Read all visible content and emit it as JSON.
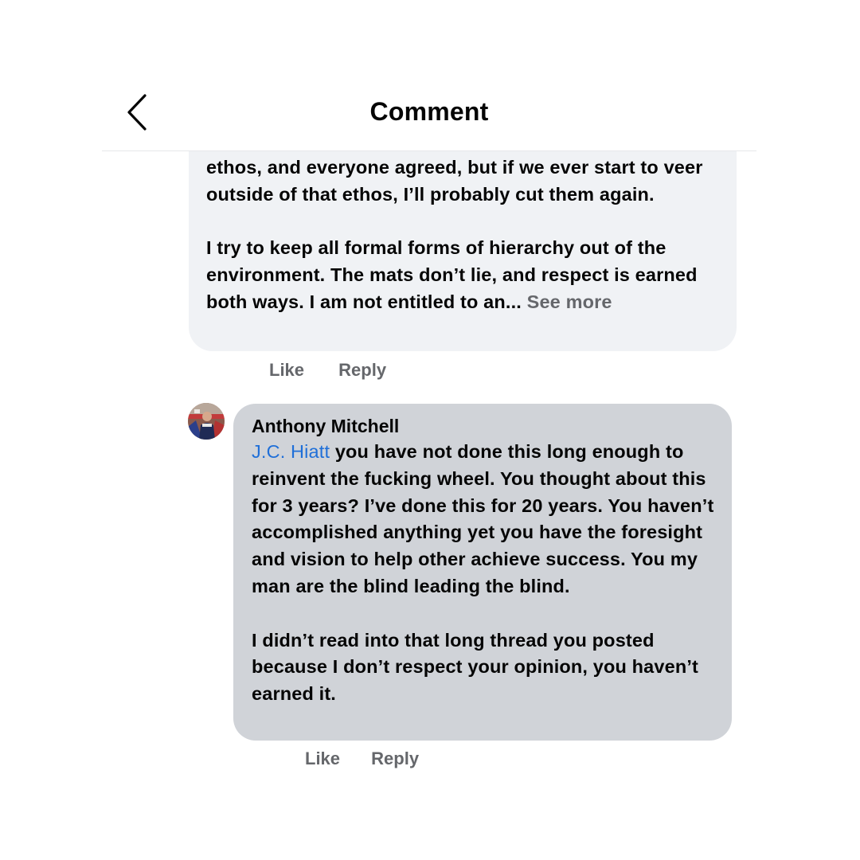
{
  "header": {
    "title": "Comment",
    "back_icon": "chevron-left-icon"
  },
  "comment_1": {
    "paragraph_1": "ethos, and everyone agreed, but if we ever start to veer outside of that ethos, I’ll probably cut them again.",
    "paragraph_2": "I try to keep all formal forms of hierarchy out of the environment. The mats don’t lie, and respect is earned both ways. I am not entitled to an...",
    "see_more": "See more",
    "like_label": "Like",
    "reply_label": "Reply"
  },
  "comment_2": {
    "author": "Anthony Mitchell",
    "mention": "J.C. Hiatt",
    "paragraph_1": " you have not done this long enough to reinvent the fucking wheel. You thought about this for 3 years? I’ve done this for 20 years. You haven’t accomplished anything yet you have the foresight and vision to help other achieve success. You my man are the blind leading the blind.",
    "paragraph_2": "I didn’t read into that long thread you posted because I don’t respect your opinion, you haven’t earned it.",
    "like_label": "Like",
    "reply_label": "Reply"
  },
  "colors": {
    "bubble_light": "#f0f2f5",
    "bubble_dark": "#d0d3d8",
    "mention": "#1f6fd8",
    "secondary_text": "#65676b"
  }
}
